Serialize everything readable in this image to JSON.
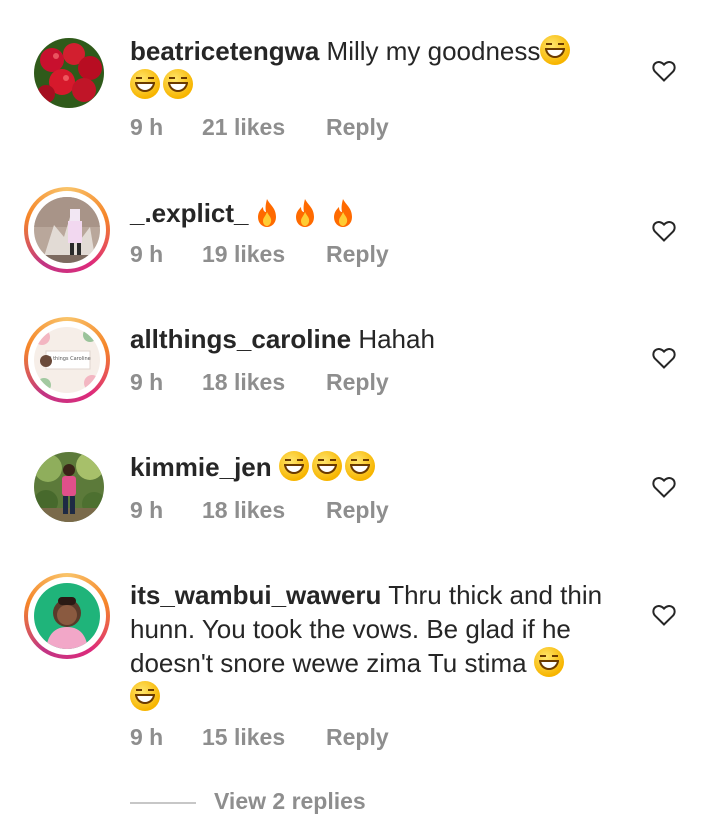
{
  "comments": [
    {
      "username": "beatricetengwa",
      "text": "Milly my goodness",
      "time": "9 h",
      "likes": "21 likes",
      "reply": "Reply"
    },
    {
      "username": "_.explict_",
      "text": "",
      "time": "9 h",
      "likes": "19 likes",
      "reply": "Reply"
    },
    {
      "username": "allthings_caroline",
      "text": "Hahah",
      "time": "9 h",
      "likes": "18 likes",
      "reply": "Reply"
    },
    {
      "username": "kimmie_jen",
      "text": "",
      "time": "9 h",
      "likes": "18 likes",
      "reply": "Reply"
    },
    {
      "username": "its_wambui_waweru",
      "text": "Thru thick and thin hunn. You took the vows. Be glad if he doesn't snore wewe zima Tu stima",
      "time": "9 h",
      "likes": "15 likes",
      "reply": "Reply"
    }
  ],
  "view_replies": "View 2 replies",
  "icons": {
    "like": "heart-outline-icon",
    "laugh": "grinning-squinting-face-emoji",
    "fire": "fire-emoji"
  },
  "colors": {
    "text": "#262626",
    "meta": "#8e8e8e",
    "story_ring": [
      "#f9c46a",
      "#f58529",
      "#dd2a7b",
      "#c13584"
    ]
  }
}
